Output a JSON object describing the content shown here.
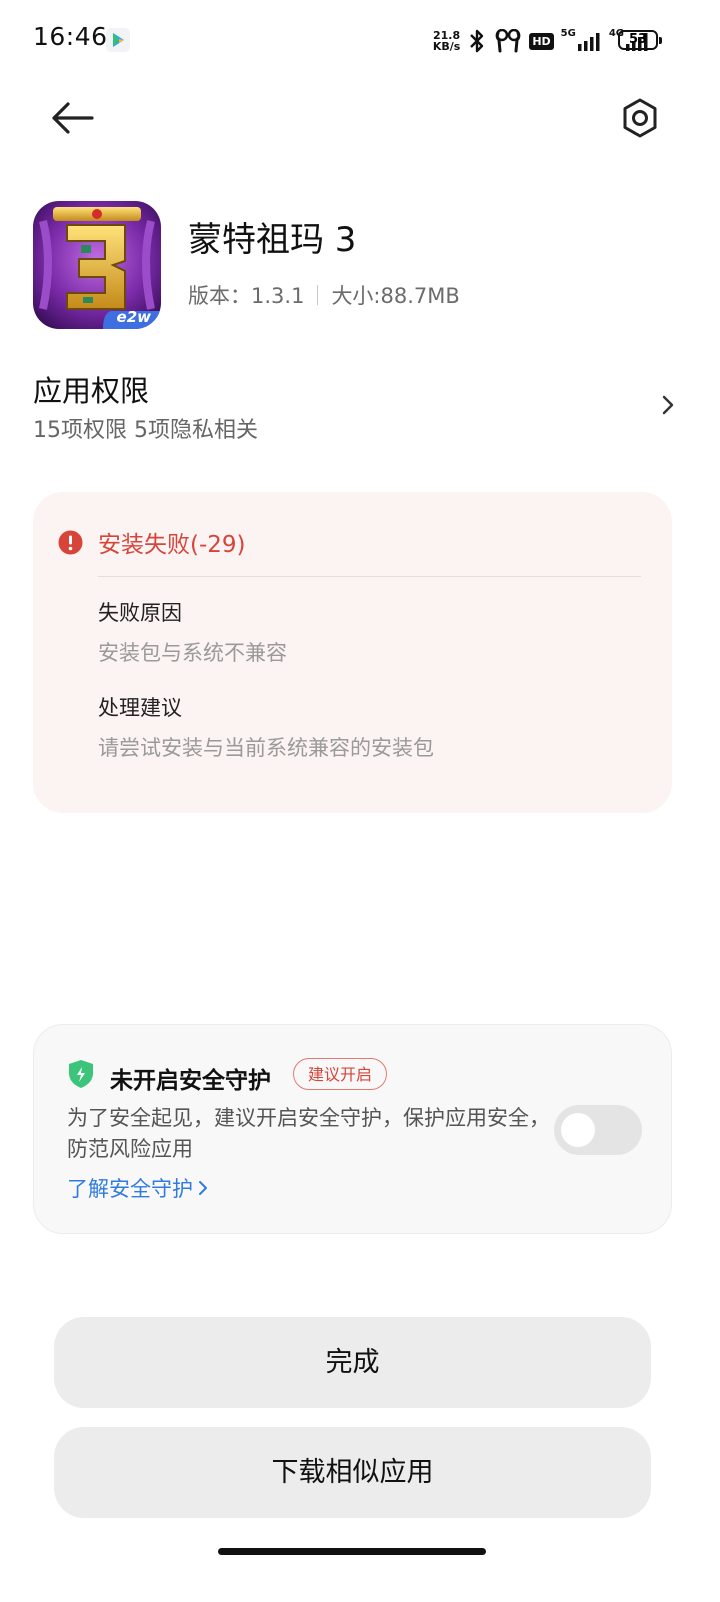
{
  "status_bar": {
    "time": "16:46",
    "net_speed_value": "21.8",
    "net_speed_unit": "KB/s",
    "hd_label": "HD",
    "signal1_label": "5G",
    "signal2_label": "4G",
    "battery": "53"
  },
  "app": {
    "name": "蒙特祖玛 3",
    "version": "版本：1.3.1",
    "size": "大小:88.7MB",
    "icon_badge": "e2w"
  },
  "permissions": {
    "title": "应用权限",
    "summary": "15项权限 5项隐私相关"
  },
  "error": {
    "title": "安装失败(-29)",
    "reason_label": "失败原因",
    "reason_text": "安装包与系统不兼容",
    "advice_label": "处理建议",
    "advice_text": "请尝试安装与当前系统兼容的安装包"
  },
  "security": {
    "title": "未开启安全守护",
    "badge": "建议开启",
    "description": "为了安全起见，建议开启安全守护，保护应用安全，防范风险应用",
    "link": "了解安全守护",
    "toggle_on": false
  },
  "buttons": {
    "done": "完成",
    "download_similar": "下载相似应用"
  },
  "colors": {
    "error_red": "#d7453a",
    "link_blue": "#2f7be0",
    "shield_green": "#3cc57a",
    "error_card_bg": "#fcf4f3"
  }
}
